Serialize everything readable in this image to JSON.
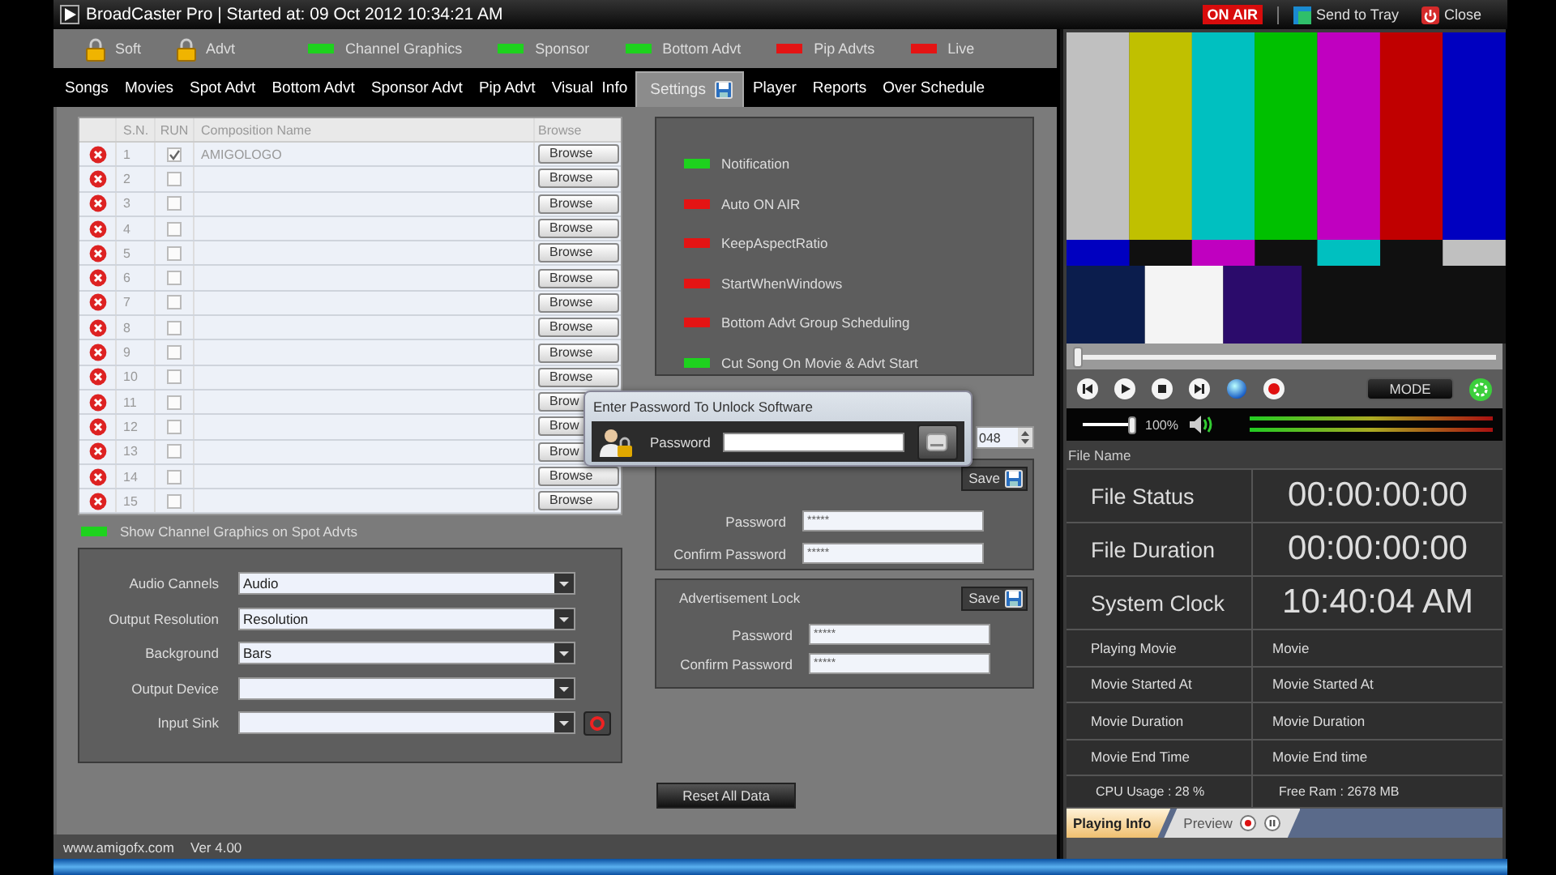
{
  "window": {
    "title": "BroadCaster Pro | Started at: 09 Oct 2012 10:34:21 AM",
    "on_air": "ON AIR",
    "send_to_tray": "Send to Tray",
    "close": "Close"
  },
  "status_bar": {
    "locks": [
      "Soft",
      "Advt"
    ],
    "indicators": [
      {
        "label": "Channel Graphics",
        "on": true
      },
      {
        "label": "Sponsor",
        "on": true
      },
      {
        "label": "Bottom Advt",
        "on": true
      },
      {
        "label": "Pip Advts",
        "on": false
      },
      {
        "label": "Live",
        "on": false
      }
    ]
  },
  "tabs": [
    {
      "label": "Songs",
      "selected": false
    },
    {
      "label": "Movies",
      "selected": false
    },
    {
      "label": "Spot Advt",
      "selected": false
    },
    {
      "label": "Bottom Advt",
      "selected": false
    },
    {
      "label": "Sponsor Advt",
      "selected": false
    },
    {
      "label": "Pip Advt",
      "selected": false
    },
    {
      "label": "Visual  Info",
      "selected": false
    },
    {
      "label": "Settings",
      "selected": true
    },
    {
      "label": "Player",
      "selected": false
    },
    {
      "label": "Reports",
      "selected": false
    },
    {
      "label": "Over Schedule",
      "selected": false
    }
  ],
  "compositions": {
    "columns": [
      "S.N.",
      "RUN",
      "Composition Name",
      "Browse"
    ],
    "rows": [
      {
        "sn": "1",
        "run": true,
        "name": "AMIGOLOGO",
        "browse": "Browse"
      },
      {
        "sn": "2",
        "run": false,
        "browse": "Browse"
      },
      {
        "sn": "3",
        "run": false,
        "browse": "Browse"
      },
      {
        "sn": "4",
        "run": false,
        "browse": "Browse"
      },
      {
        "sn": "5",
        "run": false,
        "browse": "Browse"
      },
      {
        "sn": "6",
        "run": false,
        "browse": "Browse"
      },
      {
        "sn": "7",
        "run": false,
        "browse": "Browse"
      },
      {
        "sn": "8",
        "run": false,
        "browse": "Browse"
      },
      {
        "sn": "9",
        "run": false,
        "browse": "Browse"
      },
      {
        "sn": "10",
        "run": false,
        "browse": "Browse"
      },
      {
        "sn": "11",
        "run": false,
        "browse": "Brow"
      },
      {
        "sn": "12",
        "run": false,
        "browse": "Brow"
      },
      {
        "sn": "13",
        "run": false,
        "browse": "Brow"
      },
      {
        "sn": "14",
        "run": false,
        "browse": "Browse"
      },
      {
        "sn": "15",
        "run": false,
        "browse": "Browse"
      }
    ]
  },
  "show_channel_graphics": {
    "label": "Show Channel Graphics on Spot Advts",
    "on": true
  },
  "output_settings": [
    {
      "label": "Audio Cannels",
      "value": "Audio",
      "record_button": false
    },
    {
      "label": "Output Resolution",
      "value": "Resolution",
      "record_button": false
    },
    {
      "label": "Background",
      "value": "Bars",
      "record_button": false
    },
    {
      "label": "Output Device",
      "record_button": false
    },
    {
      "label": "Input Sink",
      "record_button": true
    }
  ],
  "options": [
    {
      "label": "Notification",
      "on": true
    },
    {
      "label": "Auto ON AIR",
      "on": false
    },
    {
      "label": "KeepAspectRatio",
      "on": false
    },
    {
      "label": "StartWhenWindows",
      "on": false
    },
    {
      "label": "Bottom Advt  Group Scheduling",
      "on": false
    },
    {
      "label": "Cut Song On Movie & Advt Start",
      "on": true
    }
  ],
  "spinner": {
    "value": "048"
  },
  "screen_lock": {
    "save": "Save",
    "fields": [
      {
        "label": "Password",
        "value": "*****"
      },
      {
        "label": "Confirm Password",
        "value": "*****"
      }
    ]
  },
  "advertisement_lock": {
    "title": "Advertisement Lock",
    "save": "Save",
    "fields": [
      {
        "label": "Password",
        "value": "*****"
      },
      {
        "label": "Confirm Password",
        "value": "*****"
      }
    ]
  },
  "reset_button": "Reset All Data",
  "footer": {
    "site": "www.amigofx.com",
    "version": "Ver 4.00"
  },
  "player": {
    "seek": {
      "level": 0
    },
    "mode": "MODE",
    "volume": {
      "level": 1,
      "reading": "100%"
    },
    "file_name": "File Name",
    "info": [
      {
        "kind": "big",
        "label": "File Status",
        "value": "00:00:00:00"
      },
      {
        "kind": "big",
        "label": "File Duration",
        "value": "00:00:00:00"
      },
      {
        "kind": "big",
        "label": "System Clock",
        "value": "10:40:04 AM"
      },
      {
        "kind": "small",
        "label": "Playing Movie",
        "value": "Movie"
      },
      {
        "kind": "small",
        "label": "Movie Started At",
        "value": "Movie Started At"
      },
      {
        "kind": "small",
        "label": "Movie Duration",
        "value": "Movie Duration"
      },
      {
        "kind": "small",
        "label": "Movie End Time",
        "value": "Movie End time"
      }
    ],
    "cpu": "CPU Usage :  28 %",
    "ram": "Free Ram :  2678 MB",
    "tabs": [
      {
        "label": "Playing Info",
        "selected": true
      },
      {
        "label": "Preview",
        "selected": false
      }
    ]
  },
  "dialog": {
    "title": "Enter Password To Unlock Software",
    "label": "Password"
  }
}
